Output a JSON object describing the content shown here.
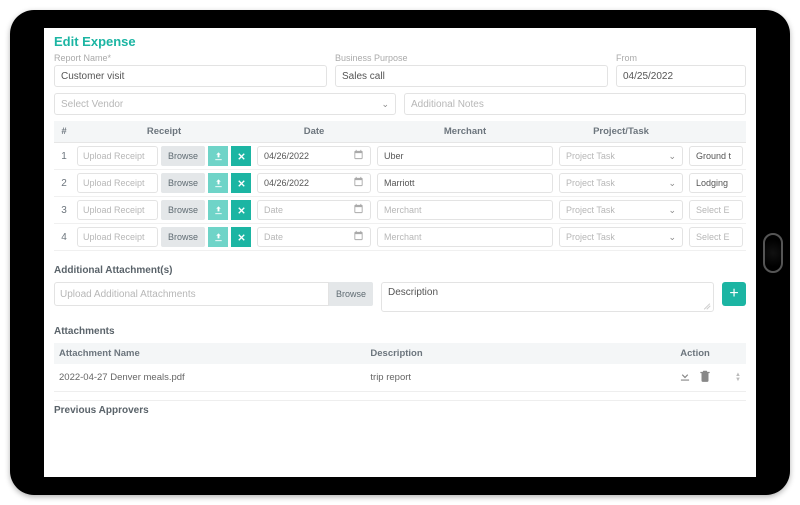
{
  "page_title": "Edit Expense",
  "fields": {
    "report_name_label": "Report Name*",
    "report_name_value": "Customer visit",
    "business_purpose_label": "Business Purpose",
    "business_purpose_value": "Sales call",
    "from_label": "From",
    "from_value": "04/25/2022",
    "vendor_placeholder": "Select Vendor",
    "notes_placeholder": "Additional Notes"
  },
  "table": {
    "headers": {
      "num": "#",
      "receipt": "Receipt",
      "date": "Date",
      "merchant": "Merchant",
      "project": "Project/Task"
    },
    "upload_placeholder": "Upload Receipt",
    "browse_label": "Browse",
    "date_placeholder": "Date",
    "merchant_placeholder": "Merchant",
    "project_placeholder": "Project Task",
    "expense_placeholder": "Select E",
    "rows": [
      {
        "num": "1",
        "date": "04/26/2022",
        "merchant": "Uber",
        "project": "",
        "expense": "Ground t"
      },
      {
        "num": "2",
        "date": "04/26/2022",
        "merchant": "Marriott",
        "project": "",
        "expense": "Lodging"
      },
      {
        "num": "3",
        "date": "",
        "merchant": "",
        "project": "",
        "expense": ""
      },
      {
        "num": "4",
        "date": "",
        "merchant": "",
        "project": "",
        "expense": ""
      }
    ]
  },
  "additional_attachments": {
    "heading": "Additional Attachment(s)",
    "upload_placeholder": "Upload Additional Attachments",
    "browse_label": "Browse",
    "description_placeholder": "Description"
  },
  "attachments": {
    "heading": "Attachments",
    "headers": {
      "name": "Attachment Name",
      "desc": "Description",
      "action": "Action"
    },
    "rows": [
      {
        "name": "2022-04-27 Denver meals.pdf",
        "desc": "trip report"
      }
    ]
  },
  "previous_approvers": "Previous Approvers"
}
